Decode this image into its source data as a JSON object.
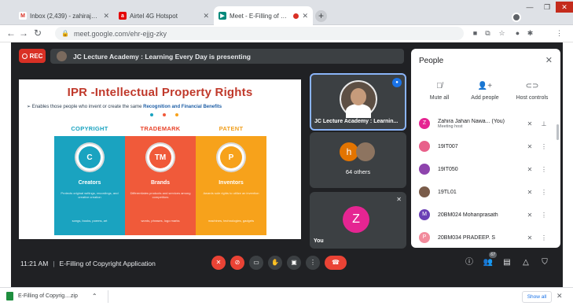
{
  "browser": {
    "tabs": [
      {
        "title": "Inbox (2,439) - zahirajahan.nawa...",
        "favicon": "gmail-icon",
        "active": false
      },
      {
        "title": "Airtel 4G Hotspot",
        "favicon": "airtel-icon",
        "active": false
      },
      {
        "title": "Meet - E-Filling of Copyright...",
        "favicon": "meet-icon",
        "active": true
      }
    ],
    "url": "meet.google.com/ehr-ejjg-zky",
    "profile_initial": "Z"
  },
  "meet": {
    "rec_label": "REC",
    "presenting_banner": "JC Lecture Academy : Learning Every Day is presenting",
    "slide": {
      "title": "IPR -Intellectual Property Rights",
      "subtitle_prefix": "➢  Enables those people who invent or create the same ",
      "subtitle_bold": "Recognition and Financial Benefits",
      "columns": [
        {
          "heading": "COPYRIGHT",
          "letter": "C",
          "name": "Creators",
          "desc": "Protects original writings, recordings, and creative creation",
          "foot": "songs, books, poems, art",
          "color": "#1aa3c0",
          "head_color": "#1aa3c0"
        },
        {
          "heading": "TRADEMARK",
          "letter": "TM",
          "name": "Brands",
          "desc": "Differentiates products and services among competitors",
          "foot": "words, phrases, logo marks",
          "color": "#f05a3a",
          "head_color": "#e8452c"
        },
        {
          "heading": "PATENT",
          "letter": "P",
          "name": "Inventors",
          "desc": "Awards sole rights to utilize an invention",
          "foot": "machines, technologies, gadgets",
          "color": "#f7a21b",
          "head_color": "#f0a020"
        }
      ]
    },
    "tiles": {
      "presenter_label": "JC Lecture Academy : Learnin...",
      "others_initial": "h",
      "others_count": "64 others",
      "self_initial": "Z",
      "self_label": "You"
    },
    "bottom": {
      "time": "11:21 AM",
      "meeting_name": "E-Filling of Copyright Application",
      "people_badge": "67"
    },
    "people_panel": {
      "title": "People",
      "actions": [
        {
          "label": "Mute all",
          "icon": "mic-off-icon"
        },
        {
          "label": "Add people",
          "icon": "add-person-icon"
        },
        {
          "label": "Host controls",
          "icon": "toggle-icon"
        }
      ],
      "participants": [
        {
          "name": "Zahira Jahan Nawa...",
          "suffix": "(You)",
          "role": "Meeting host",
          "initial": "Z",
          "color": "#e52592"
        },
        {
          "name": "19IT007",
          "suffix": "",
          "role": "",
          "initial": "",
          "color": "#e8608a"
        },
        {
          "name": "19IT050",
          "suffix": "",
          "role": "",
          "initial": "",
          "color": "#8e44ad"
        },
        {
          "name": "19TL01",
          "suffix": "",
          "role": "",
          "initial": "",
          "color": "#7a5c4a"
        },
        {
          "name": "20BM024 Mohanprasath",
          "suffix": "",
          "role": "",
          "initial": "M",
          "color": "#6a3fb5"
        },
        {
          "name": "20BM034 PRADEEP. S",
          "suffix": "",
          "role": "",
          "initial": "P",
          "color": "#f28b9c"
        }
      ]
    }
  },
  "downloads": {
    "file_name": "E-Filling of Copyrig....zip",
    "show_all": "Show all"
  }
}
